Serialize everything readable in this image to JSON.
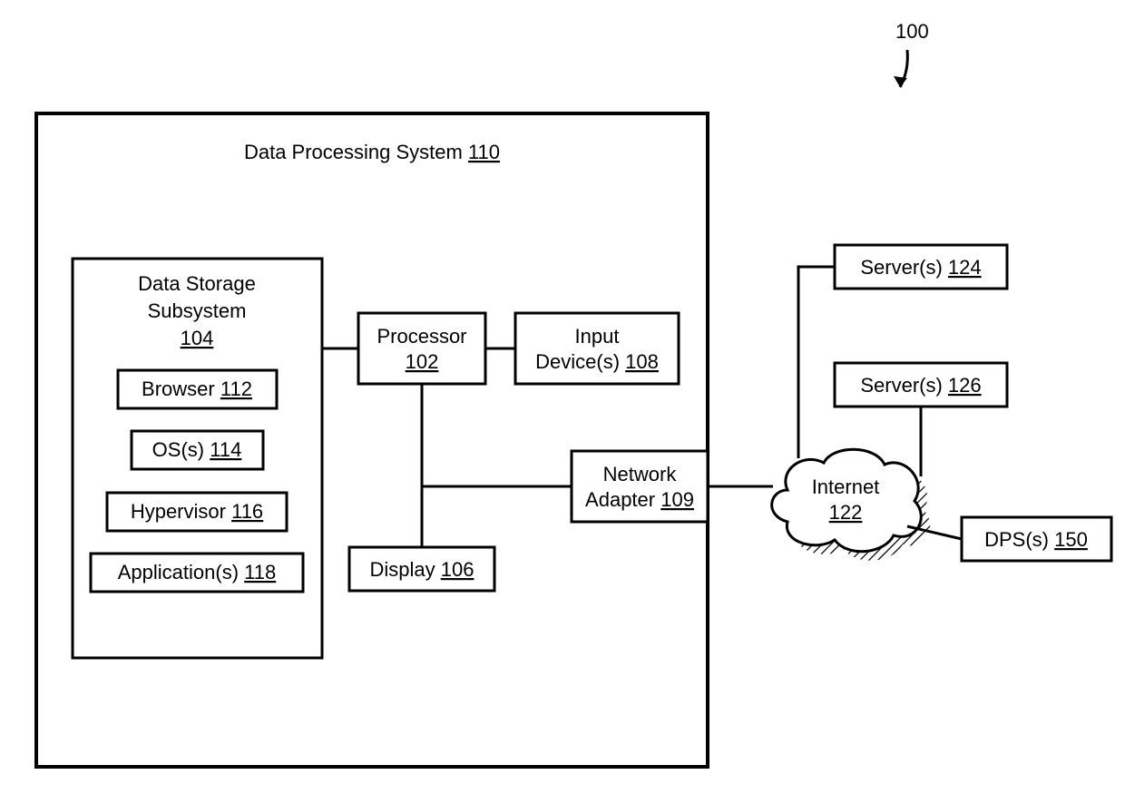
{
  "figure_ref": "100",
  "dps": {
    "label": "Data Processing System",
    "ref": "110"
  },
  "storage": {
    "label_line1": "Data Storage",
    "label_line2": "Subsystem",
    "ref": "104",
    "browser": {
      "label": "Browser",
      "ref": "112"
    },
    "os": {
      "label": "OS(s)",
      "ref": "114"
    },
    "hyp": {
      "label": "Hypervisor",
      "ref": "116"
    },
    "app": {
      "label": "Application(s)",
      "ref": "118"
    }
  },
  "processor": {
    "label": "Processor",
    "ref": "102"
  },
  "input": {
    "label_line1": "Input",
    "label_line2": "Device(s)",
    "ref": "108"
  },
  "display": {
    "label": "Display",
    "ref": "106"
  },
  "netadapter": {
    "label_line1": "Network",
    "label_line2": "Adapter",
    "ref": "109"
  },
  "internet": {
    "label": "Internet",
    "ref": "122"
  },
  "server1": {
    "label": "Server(s)",
    "ref": "124"
  },
  "server2": {
    "label": "Server(s)",
    "ref": "126"
  },
  "dps2": {
    "label": "DPS(s)",
    "ref": "150"
  }
}
